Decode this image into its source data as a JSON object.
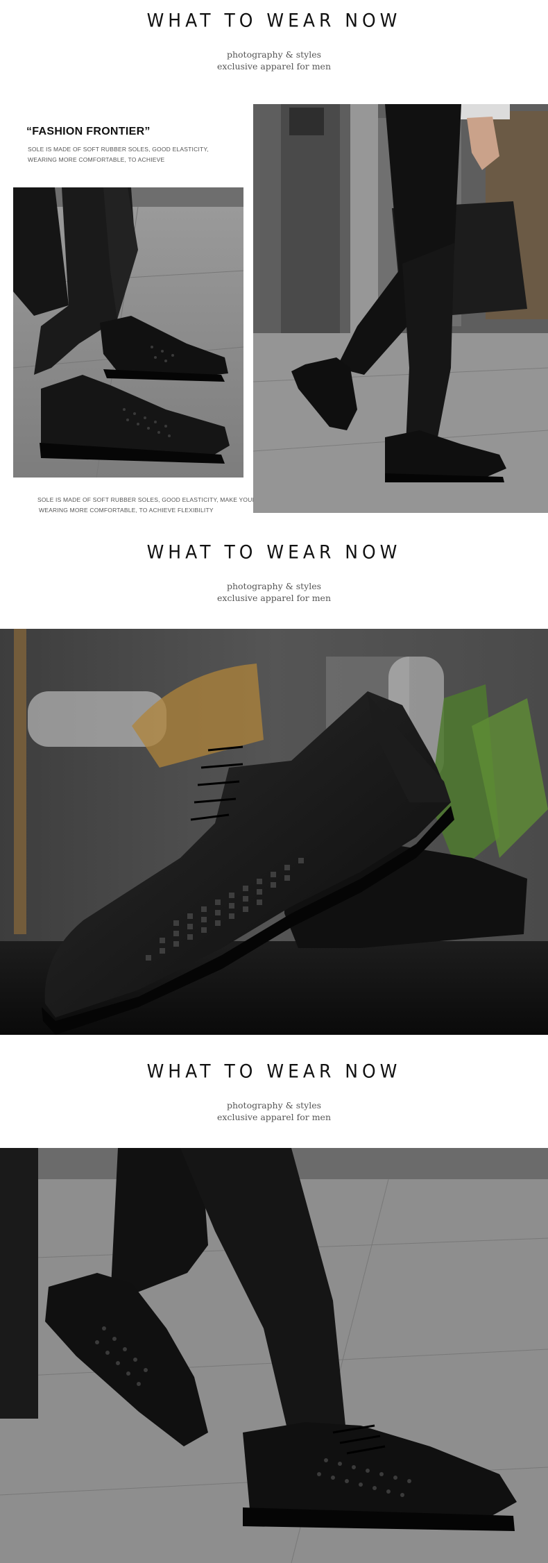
{
  "sections": [
    {
      "headline": "WHAT TO WEAR NOW",
      "sub_line1": "photography & styles",
      "sub_line2": "exclusive apparel for men"
    },
    {
      "headline": "WHAT TO WEAR NOW",
      "sub_line1": "photography & styles",
      "sub_line2": "exclusive apparel for men"
    },
    {
      "headline": "WHAT TO WEAR NOW",
      "sub_line1": "photography & styles",
      "sub_line2": "exclusive apparel for men"
    }
  ],
  "feature": {
    "title": "“FASHION FRONTIER”",
    "desc_line1": "SOLE IS MADE OF SOFT RUBBER SOLES, GOOD ELASTICITY,",
    "desc_line2": "WEARING MORE COMFORTABLE, TO ACHIEVE",
    "caption_line1": "SOLE IS MADE OF SOFT RUBBER SOLES, GOOD ELASTICITY, MAKE YOUR",
    "caption_line2": "WEARING MORE COMFORTABLE, TO ACHIEVE FLEXIBILITY"
  },
  "photos": {
    "left_shoes": "photo-shoes-standing",
    "right_walk": "photo-man-walking",
    "hero_shoe": "photo-shoe-closeup",
    "bottom_walk": "photo-shoes-stepping"
  },
  "colors": {
    "background": "#ffffff",
    "leather": "#141414",
    "pavement": "#8a8a8a",
    "text_dark": "#111111",
    "text_muted": "#555555"
  }
}
